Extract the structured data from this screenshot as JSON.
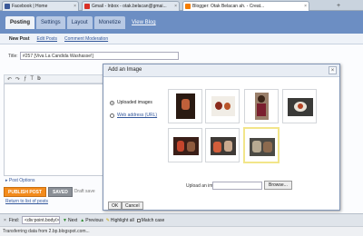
{
  "browser": {
    "tabs": [
      {
        "title": "Facebook | Home",
        "icon_color": "#3b5998"
      },
      {
        "title": "Gmail - Inbox - otak.belacan@gmai...",
        "icon_color": "#d93025"
      },
      {
        "title": "Blogger: Otak Belacan ah. - Creat...",
        "icon_color": "#f57d00"
      }
    ],
    "new_tab_label": "+"
  },
  "blogger": {
    "tabs": [
      "Posting",
      "Settings",
      "Layout",
      "Monetize"
    ],
    "view_blog": "View Blog",
    "subnav": [
      "New Post",
      "Edit Posts",
      "Comment Moderation"
    ],
    "header_color": "#6c8ec3"
  },
  "editor": {
    "title_label": "Title:",
    "title_value": "#257 [Viva La Candida Washasse!]",
    "post_options": "▸ Post Options",
    "publish_label": "PUBLISH POST",
    "saved_label": "SAVED",
    "draft_text": "Draft save",
    "return_link": "Return to list of posts"
  },
  "modal": {
    "title": "Add an Image",
    "close": "×",
    "radio_uploaded": "Uploaded images",
    "radio_web": "Web address (URL)",
    "upload_label": "Upload an image",
    "browse_label": "Browse...",
    "ok_label": "OK",
    "cancel_label": "Cancel"
  },
  "findbar": {
    "close": "×",
    "label": "Find:",
    "value": "<div:point.body/>",
    "next": "Next",
    "previous": "Previous",
    "highlight": "Highlight all",
    "match_case": "Match case"
  },
  "status": "Transferring data from 2.bp.blogspot.com..."
}
